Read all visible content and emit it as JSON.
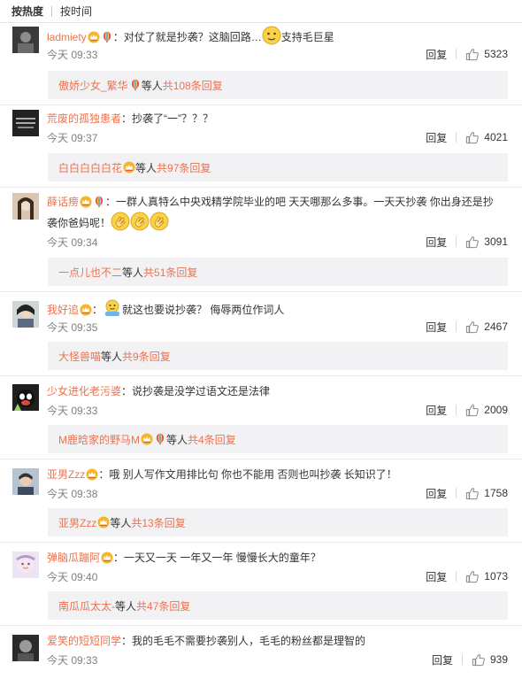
{
  "sort": {
    "hot": "按热度",
    "time": "按时间"
  },
  "reply_label": "回复",
  "icons": {
    "like": "thumbs-up-icon",
    "badge_vip": "crown-badge-icon",
    "badge_rainbow": "rainbow-balloon-icon",
    "emoji_thinking": "thinking-face-emoji",
    "emoji_clap": "clapping-emoji",
    "emoji_shrug": "shrugging-emoji"
  },
  "colors": {
    "username": "#eb7350",
    "accent": "#eb7350",
    "text": "#333333",
    "time": "#808080",
    "reply_bg": "#f2f2f5"
  },
  "comments": [
    {
      "user": "ladmiety",
      "sep": "：",
      "text_a": "对仗了就是抄袭？这脑回路…",
      "text_b": "支持毛巨星",
      "time": "今天 09:33",
      "likes": "5323",
      "reply": {
        "user": "傲娇少女_繁华",
        "etc": " 等人 ",
        "more": "共108条回复"
      }
    },
    {
      "user": "荒废的孤独患者",
      "sep": "：",
      "text_a": "抄袭了“一”？？？",
      "time": "今天 09:37",
      "likes": "4021",
      "reply": {
        "user": "白白白白白花",
        "etc": " 等人 ",
        "more": "共97条回复"
      }
    },
    {
      "user": "薛话痨",
      "sep": "：",
      "text_a": "一群人真特么中央戏精学院毕业的吧  天天哪那么多事。一天天抄袭  你出身还是抄",
      "text_b": "袭你爸妈呢！",
      "time": "今天 09:34",
      "likes": "3091",
      "reply": {
        "user": "一点儿也不二",
        "etc": " 等人 ",
        "more": "共51条回复"
      }
    },
    {
      "user": "我好追",
      "sep": "：",
      "text_a": "就这也要说抄袭？  侮辱两位作词人",
      "time": "今天 09:35",
      "likes": "2467",
      "reply": {
        "user": "大怪兽喵",
        "etc": " 等人 ",
        "more": "共9条回复"
      }
    },
    {
      "user": "少女进化老污婆",
      "sep": "：",
      "text_a": "说抄袭是没学过语文还是法律",
      "time": "今天 09:33",
      "likes": "2009",
      "reply": {
        "user": "M鹿晗家的野马M",
        "etc": " 等人 ",
        "more": "共4条回复"
      }
    },
    {
      "user": "亚男Zzz",
      "sep": "：",
      "text_a": "哦 别人写作文用排比句 你也不能用 否则也叫抄袭 长知识了！",
      "time": "今天 09:38",
      "likes": "1758",
      "reply": {
        "user": "亚男Zzz",
        "etc": " 等人 ",
        "more": "共13条回复"
      }
    },
    {
      "user": "弹脑瓜蹦阿",
      "sep": "：",
      "text_a": "一天又一天 一年又一年 慢慢长大的童年？",
      "time": "今天 09:40",
      "likes": "1073",
      "reply": {
        "user": "南瓜瓜太太-",
        "etc": " 等人 ",
        "more": "共47条回复"
      }
    },
    {
      "user": "爱笑的短短同学",
      "sep": "：",
      "text_a": "我的毛毛不需要抄袭别人，毛毛的粉丝都是理智的",
      "time": "今天 09:33",
      "likes": "939"
    }
  ]
}
